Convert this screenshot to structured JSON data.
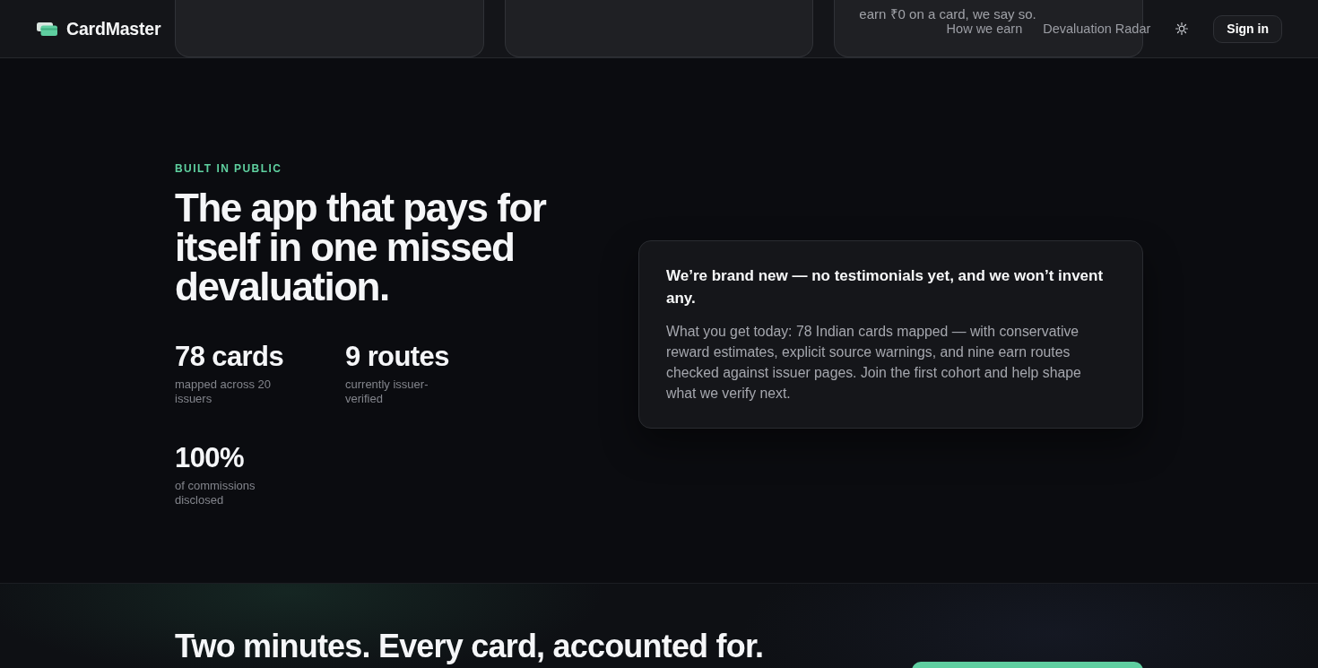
{
  "navbar": {
    "brand": "CardMaster",
    "links": [
      {
        "label": "How we earn"
      },
      {
        "label": "Devaluation Radar"
      }
    ],
    "sign_in": "Sign in"
  },
  "feature_cards": [
    {
      "kind": "blank"
    },
    {
      "kind": "blank"
    },
    {
      "kind": "text",
      "text": "earn ₹0 on a card, we say so."
    }
  ],
  "built_in_public": {
    "eyebrow": "BUILT IN PUBLIC",
    "heading": "The app that pays for itself in one missed devaluation.",
    "stats": [
      {
        "value": "78 cards",
        "label": "mapped across 20 issuers"
      },
      {
        "value": "9 routes",
        "label": "currently issuer-verified"
      },
      {
        "value": "100%",
        "label": "of commissions disclosed"
      }
    ],
    "note": {
      "title": "We’re brand new — no testimonials yet, and we won’t invent any.",
      "body": "What you get today: 78 Indian cards mapped — with conservative reward estimates, explicit source warnings, and nine earn routes checked against issuer pages. Join the first cohort and help shape what we verify next."
    }
  },
  "cta": {
    "heading": "Two minutes. Every card, accounted for."
  }
}
